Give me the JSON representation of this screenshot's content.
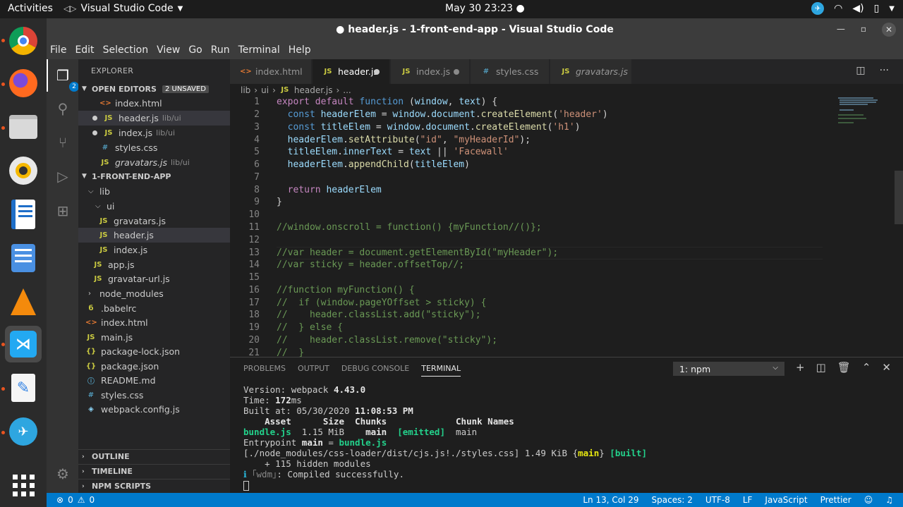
{
  "topbar": {
    "activities": "Activities",
    "app_name": "Visual Studio Code",
    "clock": "May 30  23:23 ●"
  },
  "dock": {
    "items": [
      "chrome-icon",
      "firefox-icon",
      "files-icon",
      "rhythmbox-icon",
      "writer-icon",
      "tasks-icon",
      "vlc-icon",
      "vscode-icon",
      "text-editor-icon",
      "telegram-icon",
      "apps-grid-icon"
    ]
  },
  "window": {
    "title": "● header.js - 1-front-end-app - Visual Studio Code"
  },
  "menu": [
    "File",
    "Edit",
    "Selection",
    "View",
    "Go",
    "Run",
    "Terminal",
    "Help"
  ],
  "activity": {
    "badge": "2"
  },
  "explorer": {
    "header": "EXPLORER",
    "open_editors_label": "OPEN EDITORS",
    "unsaved_label": "2 UNSAVED",
    "open_editors": [
      {
        "name": "index.html",
        "path": "",
        "icon": "html",
        "dirty": false
      },
      {
        "name": "header.js",
        "path": "lib/ui",
        "icon": "js",
        "dirty": true
      },
      {
        "name": "index.js",
        "path": "lib/ui",
        "icon": "js",
        "dirty": true
      },
      {
        "name": "styles.css",
        "path": "",
        "icon": "css",
        "dirty": false
      },
      {
        "name": "gravatars.js",
        "path": "lib/ui",
        "icon": "js",
        "dirty": false
      }
    ],
    "project_label": "1-FRONT-END-APP",
    "tree": [
      {
        "name": "lib",
        "icon": "folder"
      },
      {
        "name": "ui",
        "icon": "folder"
      },
      {
        "name": "gravatars.js",
        "icon": "js"
      },
      {
        "name": "header.js",
        "icon": "js"
      },
      {
        "name": "index.js",
        "icon": "js"
      },
      {
        "name": "app.js",
        "icon": "js"
      },
      {
        "name": "gravatar-url.js",
        "icon": "js"
      },
      {
        "name": "node_modules",
        "icon": "folder"
      },
      {
        "name": ".babelrc",
        "icon": "babel"
      },
      {
        "name": "index.html",
        "icon": "html"
      },
      {
        "name": "main.js",
        "icon": "js"
      },
      {
        "name": "package-lock.json",
        "icon": "json"
      },
      {
        "name": "package.json",
        "icon": "json"
      },
      {
        "name": "README.md",
        "icon": "info"
      },
      {
        "name": "styles.css",
        "icon": "css"
      },
      {
        "name": "webpack.config.js",
        "icon": "wp"
      }
    ],
    "outline_label": "OUTLINE",
    "timeline_label": "TIMELINE",
    "npm_scripts_label": "NPM SCRIPTS"
  },
  "tabs": [
    {
      "name": "index.html",
      "icon": "html"
    },
    {
      "name": "header.js",
      "icon": "js"
    },
    {
      "name": "index.js",
      "icon": "js"
    },
    {
      "name": "styles.css",
      "icon": "css"
    },
    {
      "name": "gravatars.js",
      "icon": "js"
    }
  ],
  "breadcrumb": {
    "part1": "lib",
    "part2": "ui",
    "file": "header.js",
    "more": "..."
  },
  "editor": {
    "line_numbers": [
      "1",
      "2",
      "3",
      "4",
      "5",
      "6",
      "7",
      "8",
      "9",
      "10",
      "11",
      "12",
      "13",
      "14",
      "15",
      "16",
      "17",
      "18",
      "19",
      "20",
      "21"
    ]
  },
  "panel": {
    "tabs": [
      "PROBLEMS",
      "OUTPUT",
      "DEBUG CONSOLE",
      "TERMINAL"
    ],
    "terminal_select": "1: npm",
    "terminal": {
      "l1a": "Version: webpack ",
      "l1b": "4.43.0",
      "l2a": "Time: ",
      "l2b": "172",
      "l2c": "ms",
      "l3a": "Built at: 05/30/2020 ",
      "l3b": "11:08:53 PM",
      "l4": "    Asset      Size  Chunks             Chunk Names",
      "l5a": "bundle.js",
      "l5b": "  1.15 MiB    ",
      "l5c": "main",
      "l5d": "  [emitted]",
      "l5e": "  main",
      "l6a": "Entrypoint ",
      "l6b": "main",
      "l6c": " = ",
      "l6d": "bundle.js",
      "l7a": "[./node_modules/css-loader/dist/cjs.js!./styles.css] 1.49 KiB {",
      "l7b": "main",
      "l7c": "} ",
      "l7d": "[built]",
      "l8": "    + 115 hidden modules",
      "l9a": "ℹ",
      "l9b": " ｢wdm｣",
      "l9c": ": Compiled successfully."
    }
  },
  "status": {
    "errors": "0",
    "warnings": "0",
    "position": "Ln 13, Col 29",
    "spaces": "Spaces: 2",
    "encoding": "UTF-8",
    "eol": "LF",
    "language": "JavaScript",
    "formatter": "Prettier"
  }
}
